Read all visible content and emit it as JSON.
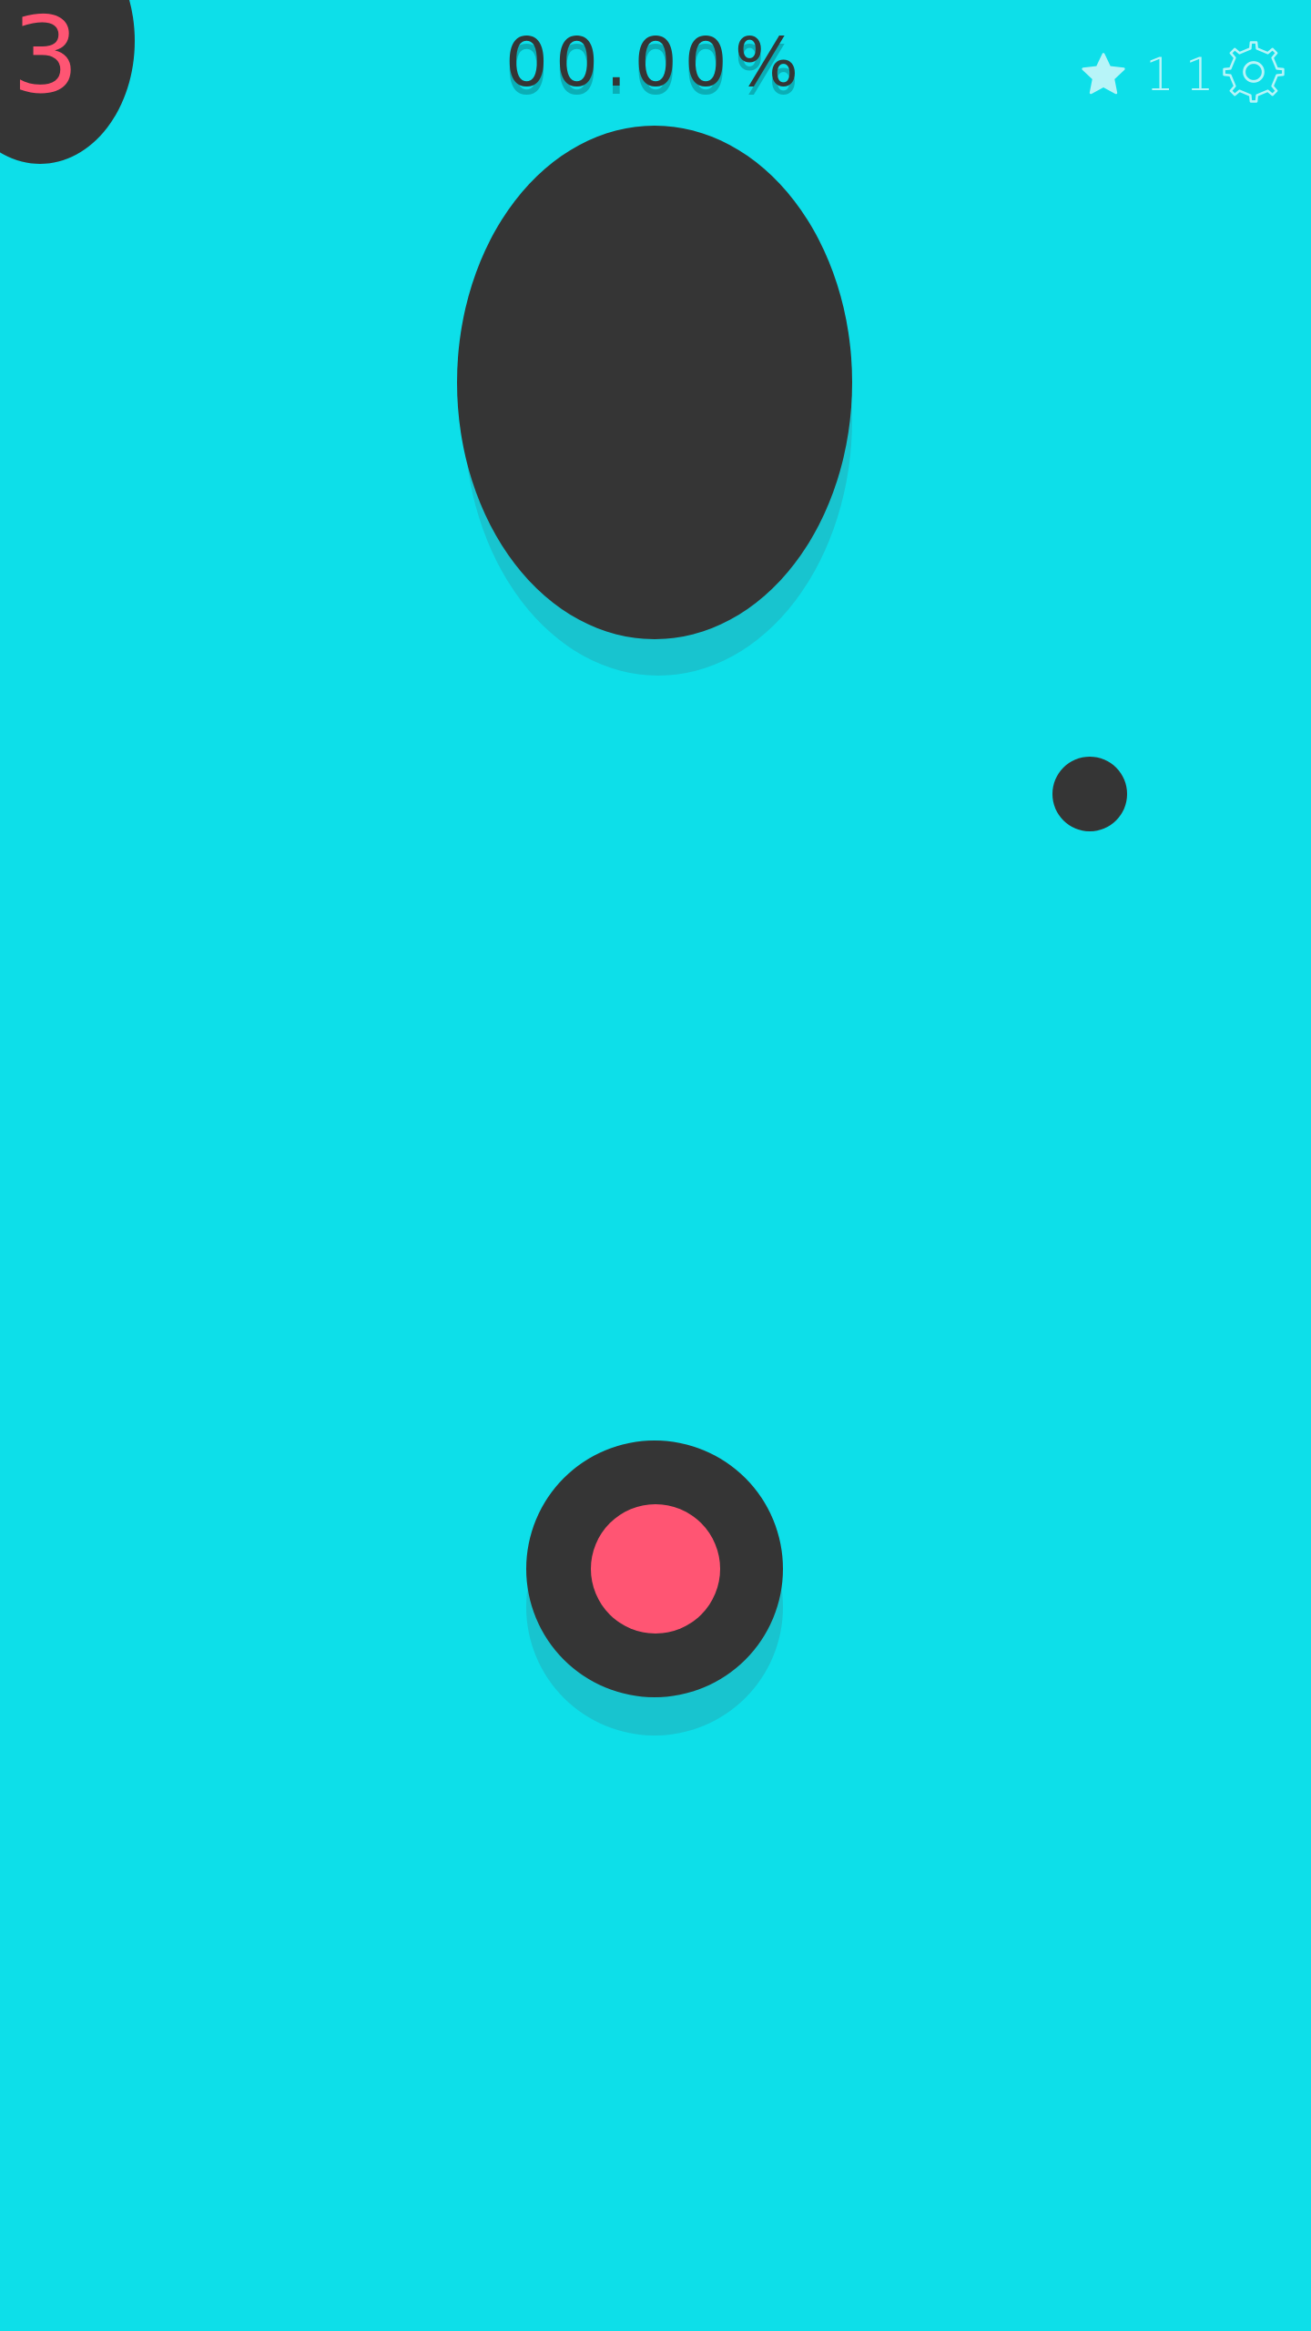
{
  "hud": {
    "level": "3",
    "progress": "00.00%",
    "star_count": "11"
  },
  "icons": {
    "star": "star-icon",
    "settings": "gear-icon"
  },
  "colors": {
    "background": "#0ddfe9",
    "dark": "#353535",
    "accent_pink": "#ff5573",
    "shadow": "#18c4cf",
    "hud_light": "#b7f4f8"
  }
}
